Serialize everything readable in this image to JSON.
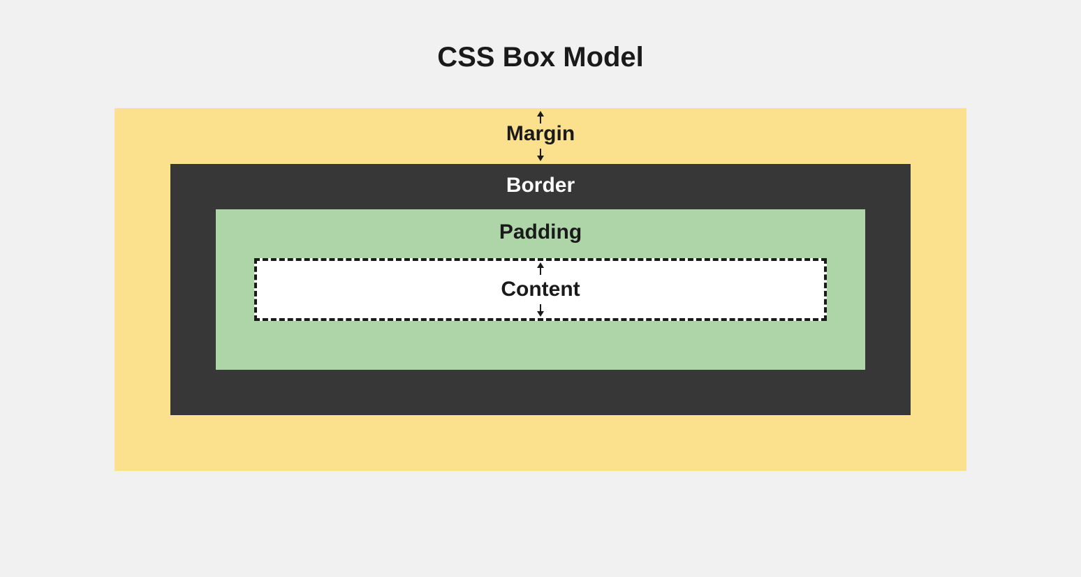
{
  "title": "CSS Box Model",
  "layers": {
    "margin": {
      "label": "Margin",
      "color": "#fbe08e"
    },
    "border": {
      "label": "Border",
      "color": "#373737"
    },
    "padding": {
      "label": "Padding",
      "color": "#aed5a8"
    },
    "content": {
      "label": "Content",
      "color": "#ffffff"
    }
  }
}
